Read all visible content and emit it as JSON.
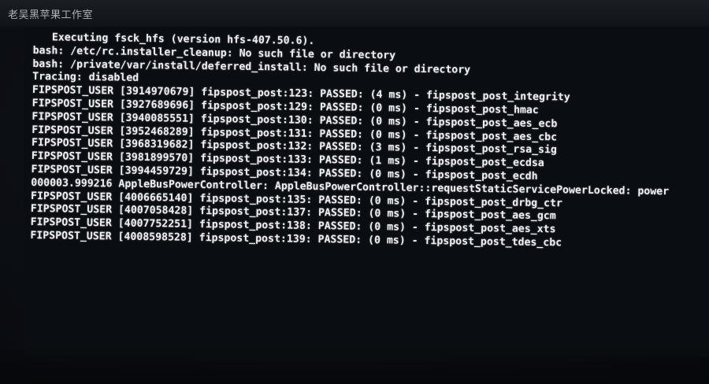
{
  "watermark": {
    "text": "老吴黑苹果工作室"
  },
  "console": {
    "lines": [
      "Executing fsck_hfs (version hfs-407.50.6).",
      "bash: /etc/rc.installer_cleanup: No such file or directory",
      "bash: /private/var/install/deferred_install: No such file or directory",
      "Tracing: disabled",
      "FIPSPOST_USER [3914970679] fipspost_post:123: PASSED: (4 ms) - fipspost_post_integrity",
      "FIPSPOST_USER [3927689696] fipspost_post:129: PASSED: (0 ms) - fipspost_post_hmac",
      "FIPSPOST_USER [3940085551] fipspost_post:130: PASSED: (0 ms) - fipspost_post_aes_ecb",
      "FIPSPOST_USER [3952468289] fipspost_post:131: PASSED: (0 ms) - fipspost_post_aes_cbc",
      "FIPSPOST_USER [3968319682] fipspost_post:132: PASSED: (3 ms) - fipspost_post_rsa_sig",
      "FIPSPOST_USER [3981899570] fipspost_post:133: PASSED: (1 ms) - fipspost_post_ecdsa",
      "FIPSPOST_USER [3994459729] fipspost_post:134: PASSED: (0 ms) - fipspost_post_ecdh",
      "000003.999216 AppleBusPowerController: AppleBusPowerController::requestStaticServicePowerLocked: power",
      "FIPSPOST_USER [4006665140] fipspost_post:135: PASSED: (0 ms) - fipspost_post_drbg_ctr",
      "FIPSPOST_USER [4007058428] fipspost_post:137: PASSED: (0 ms) - fipspost_post_aes_gcm",
      "FIPSPOST_USER [4007752251] fipspost_post:138: PASSED: (0 ms) - fipspost_post_aes_xts",
      "FIPSPOST_USER [4008598528] fipspost_post:139: PASSED: (0 ms) - fipspost_post_tdes_cbc"
    ]
  },
  "colors": {
    "screen_background": "#0a0d11",
    "text": "#eef0f2"
  }
}
